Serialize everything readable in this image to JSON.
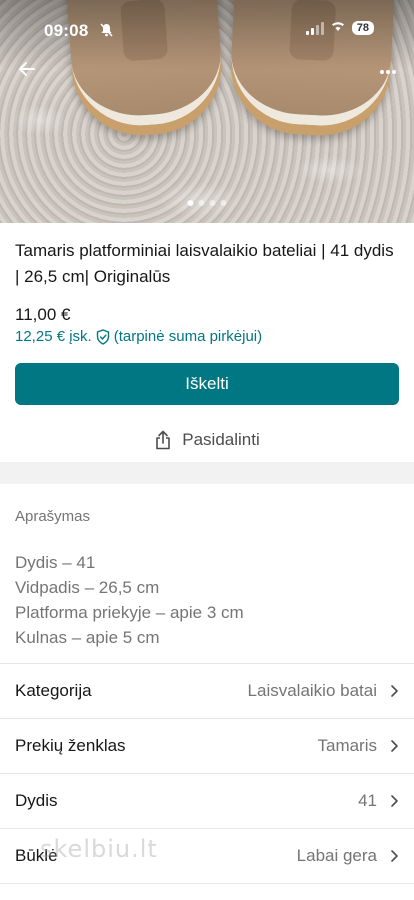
{
  "status_bar": {
    "time": "09:08",
    "battery": "78"
  },
  "gallery": {
    "page_count": 4,
    "active_index": 0
  },
  "item": {
    "title": "Tamaris platforminiai laisvalaikio bateliai | 41 dydis | 26,5 cm| Originalūs",
    "price": "11,00 €",
    "price_incl": "12,25 € įsk.",
    "price_incl_note": "(tarpinė suma pirkėjui)"
  },
  "actions": {
    "bump_label": "Iškelti",
    "share_label": "Pasidalinti"
  },
  "description": {
    "label": "Aprašymas",
    "lines": [
      "Dydis – 41",
      "Vidpadis – 26,5 cm",
      "Platforma priekyje – apie 3 cm",
      "Kulnas – apie 5 cm"
    ]
  },
  "details": [
    {
      "label": "Kategorija",
      "value": "Laisvalaikio batai"
    },
    {
      "label": "Prekių ženklas",
      "value": "Tamaris"
    },
    {
      "label": "Dydis",
      "value": "41"
    },
    {
      "label": "Būklė",
      "value": "Labai gera"
    }
  ],
  "watermark": "skelbiu.lt",
  "colors": {
    "accent": "#007782",
    "muted_text": "#757575",
    "divider": "#e7e7e7"
  },
  "icons": {
    "back": "arrow-left-icon",
    "more": "more-horizontal-icon",
    "shield": "shield-check-icon",
    "share": "share-icon",
    "chevron": "chevron-right-icon"
  }
}
